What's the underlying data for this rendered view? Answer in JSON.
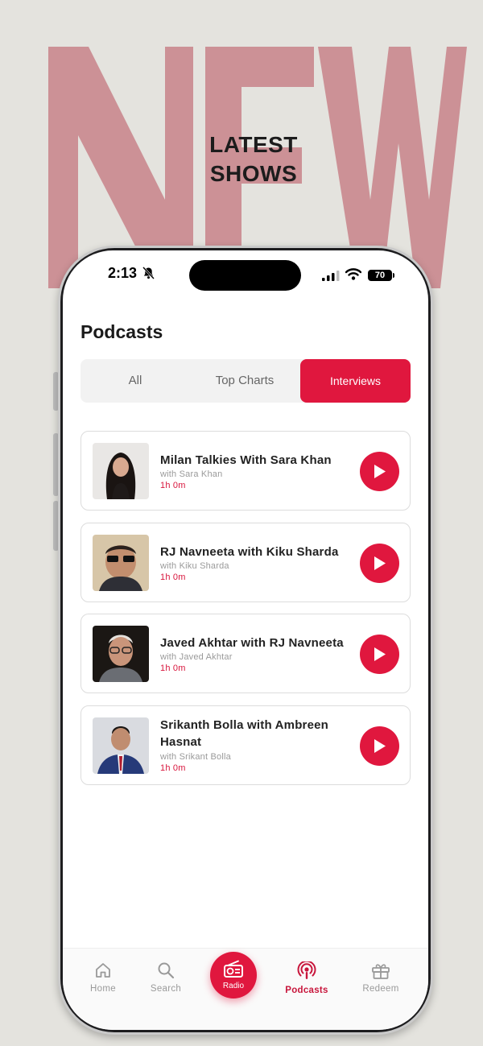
{
  "promo": {
    "background_word": "NEW",
    "headline_line1": "LATEST",
    "headline_line2": "SHOWS",
    "colors": {
      "word": "#cc9196",
      "background": "#e4e3de"
    }
  },
  "status_bar": {
    "time": "2:13",
    "battery": "70",
    "icons": [
      "bell-slash-icon",
      "signal-icon",
      "wifi-icon",
      "battery-icon"
    ]
  },
  "page": {
    "title": "Podcasts"
  },
  "tabs": [
    {
      "label": "All",
      "active": false
    },
    {
      "label": "Top Charts",
      "active": false
    },
    {
      "label": "Interviews",
      "active": true
    }
  ],
  "podcasts": [
    {
      "title": "Milan Talkies With Sara Khan",
      "subtitle": "with Sara Khan",
      "duration": "1h 0m"
    },
    {
      "title": "RJ Navneeta with Kiku Sharda",
      "subtitle": "with Kiku Sharda",
      "duration": "1h 0m"
    },
    {
      "title": "Javed Akhtar with RJ Navneeta",
      "subtitle": "with Javed Akhtar",
      "duration": "1h 0m"
    },
    {
      "title": "Srikanth Bolla with Ambreen Hasnat",
      "subtitle": "with Srikant Bolla",
      "duration": "1h 0m"
    }
  ],
  "bottom_nav": [
    {
      "label": "Home",
      "icon": "home-icon",
      "active": false
    },
    {
      "label": "Search",
      "icon": "search-icon",
      "active": false
    },
    {
      "label": "Radio",
      "icon": "radio-icon",
      "active": false
    },
    {
      "label": "Podcasts",
      "icon": "podcast-icon",
      "active": true
    },
    {
      "label": "Redeem",
      "icon": "gift-icon",
      "active": false
    }
  ],
  "colors": {
    "accent": "#e0173e",
    "text": "#222222",
    "muted": "#9a9a9a"
  }
}
